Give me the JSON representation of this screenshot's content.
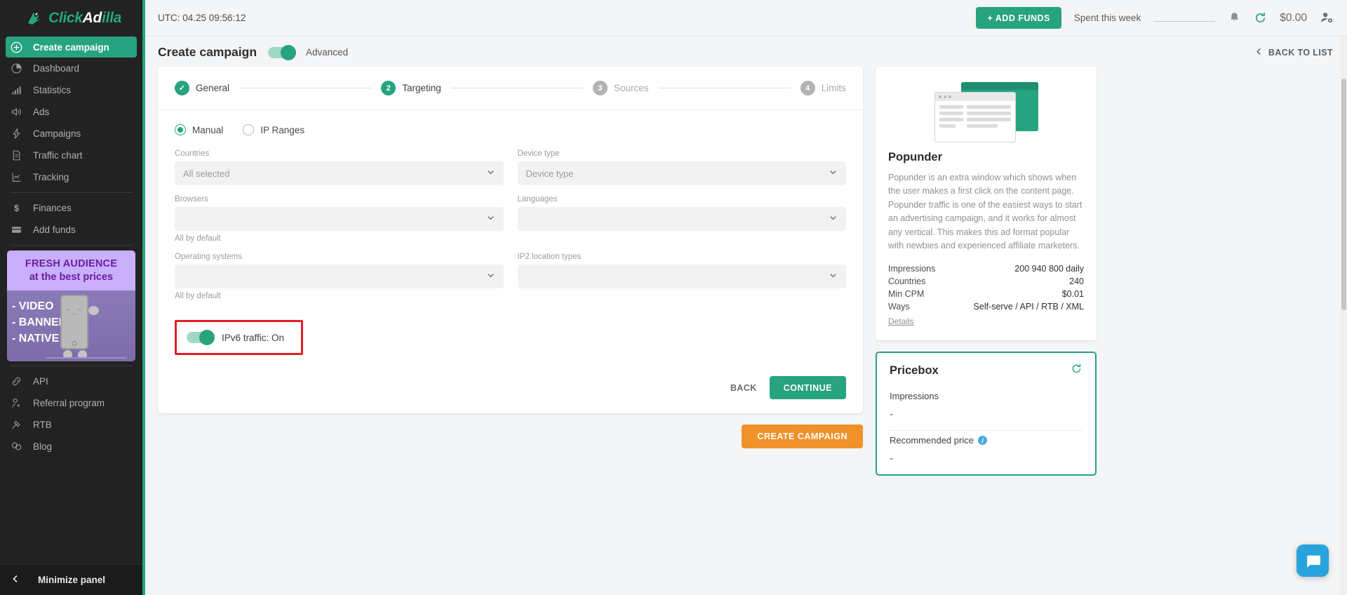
{
  "brand": {
    "name_green_1": "Click",
    "name_white": "Ad",
    "name_green_2": "illa",
    "accent_color": "#27a37f",
    "orange_color": "#f0912a",
    "highlight_color": "#e41f26"
  },
  "sidebar": {
    "primary_item": {
      "label": "Create campaign",
      "icon": "plus-circle-icon"
    },
    "items": [
      {
        "label": "Dashboard",
        "icon": "pie-chart-icon"
      },
      {
        "label": "Statistics",
        "icon": "bar-chart-icon"
      },
      {
        "label": "Ads",
        "icon": "speaker-icon"
      },
      {
        "label": "Campaigns",
        "icon": "lightning-icon"
      },
      {
        "label": "Traffic chart",
        "icon": "document-icon"
      },
      {
        "label": "Tracking",
        "icon": "line-chart-icon"
      }
    ],
    "items2": [
      {
        "label": "Finances",
        "icon": "dollar-icon"
      },
      {
        "label": "Add funds",
        "icon": "credit-card-icon"
      }
    ],
    "items3": [
      {
        "label": "API",
        "icon": "link-icon"
      },
      {
        "label": "Referral program",
        "icon": "user-arrow-icon"
      },
      {
        "label": "RTB",
        "icon": "auction-icon"
      },
      {
        "label": "Blog",
        "icon": "chat-icon"
      }
    ],
    "promo": {
      "line1": "FRESH AUDIENCE",
      "line2": "at the best prices",
      "bullets": "- VIDEO\n- BANNER\n- NATIVE"
    },
    "minimize": {
      "label": "Minimize panel",
      "icon": "chevron-left-icon"
    }
  },
  "topbar": {
    "utc": "UTC: 04.25 09:56:12",
    "add_funds": "+ ADD FUNDS",
    "spent_this_week": "Spent this week",
    "balance": "$0.00",
    "notification_icon": "bell-icon",
    "refresh_icon": "refresh-icon",
    "account_icon": "user-gear-icon"
  },
  "page": {
    "title": "Create campaign",
    "advanced_label": "Advanced",
    "advanced_on": true,
    "back_to_list": "BACK TO LIST"
  },
  "stepper": {
    "steps": [
      {
        "num": "1",
        "label": "General",
        "state": "done",
        "glyph": "✓"
      },
      {
        "num": "2",
        "label": "Targeting",
        "state": "current",
        "glyph": "2"
      },
      {
        "num": "3",
        "label": "Sources",
        "state": "pending",
        "glyph": "3"
      },
      {
        "num": "4",
        "label": "Limits",
        "state": "pending",
        "glyph": "4"
      }
    ]
  },
  "targeting": {
    "mode_options": [
      {
        "label": "Manual",
        "selected": true
      },
      {
        "label": "IP Ranges",
        "selected": false
      }
    ],
    "fields": [
      {
        "label": "Countries",
        "value": "All selected",
        "hint": ""
      },
      {
        "label": "Device type",
        "value": "Device type",
        "hint": ""
      },
      {
        "label": "Browsers",
        "value": "",
        "hint": "All by default"
      },
      {
        "label": "Languages",
        "value": "",
        "hint": ""
      },
      {
        "label": "Operating systems",
        "value": "",
        "hint": "All by default"
      },
      {
        "label": "IP2 location types",
        "value": "",
        "hint": ""
      }
    ],
    "ipv6": {
      "label": "IPv6 traffic: On",
      "on": true
    },
    "back_label": "BACK",
    "continue_label": "CONTINUE",
    "create_campaign_label": "CREATE CAMPAIGN"
  },
  "info_panel": {
    "title": "Popunder",
    "description": "Popunder is an extra window which shows when the user makes a first click on the content page. Popunder traffic is one of the easiest ways to start an advertising campaign, and it works for almost any vertical. This makes this ad format popular with newbies and experienced affiliate marketers.",
    "stats": [
      {
        "key": "Impressions",
        "value": "200 940 800 daily"
      },
      {
        "key": "Countries",
        "value": "240"
      },
      {
        "key": "Min CPM",
        "value": "$0.01"
      },
      {
        "key": "Ways",
        "value": "Self-serve / API / RTB / XML"
      }
    ],
    "details_link": "Details"
  },
  "pricebox": {
    "title": "Pricebox",
    "refresh_icon": "refresh-icon",
    "blocks": [
      {
        "label": "Impressions",
        "value": "-",
        "has_info": false
      },
      {
        "label": "Recommended price",
        "value": "-",
        "has_info": true
      }
    ]
  },
  "chat": {
    "icon": "chat-bubble-icon"
  }
}
